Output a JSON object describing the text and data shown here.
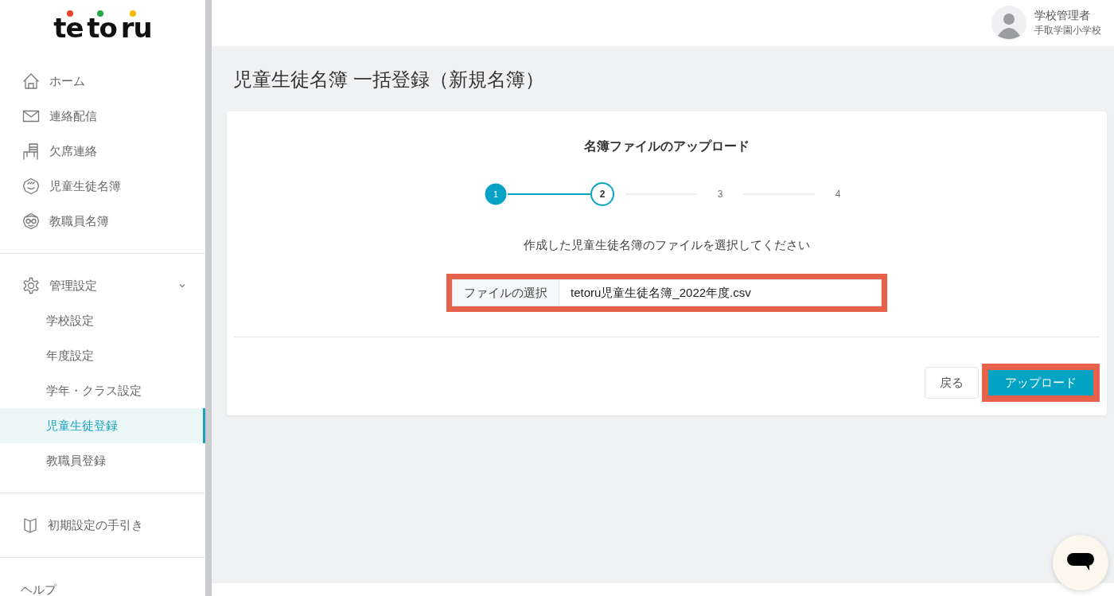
{
  "logo": "te to ru",
  "sidebar": {
    "main_items": [
      {
        "label": "ホーム",
        "selected": false
      },
      {
        "label": "連絡配信",
        "selected": false
      },
      {
        "label": "欠席連絡",
        "selected": false
      },
      {
        "label": "児童生徒名簿",
        "selected": false
      },
      {
        "label": "教職員名簿",
        "selected": false
      }
    ],
    "settings": {
      "label": "管理設定",
      "expanded": true,
      "children": [
        {
          "label": "学校設定",
          "selected": false
        },
        {
          "label": "年度設定",
          "selected": false
        },
        {
          "label": "学年・クラス設定",
          "selected": false
        },
        {
          "label": "児童生徒登録",
          "selected": true
        },
        {
          "label": "教職員登録",
          "selected": false
        }
      ]
    },
    "guide": {
      "label": "初期設定の手引き"
    },
    "help": {
      "label": "ヘルプ"
    }
  },
  "header": {
    "user": {
      "name": "学校管理者",
      "school": "手取学園小学校"
    }
  },
  "page_title": "児童生徒名簿 一括登録（新規名簿）",
  "card": {
    "title": "名簿ファイルのアップロード",
    "steps": [
      {
        "label": "1",
        "completed": true,
        "active": false
      },
      {
        "label": "2",
        "completed": false,
        "active": true
      },
      {
        "label": "3",
        "completed": false,
        "active": false
      },
      {
        "label": "4",
        "completed": false,
        "active": false
      }
    ],
    "instruction": "作成した児童生徒名簿のファイルを選択してください",
    "file_field": {
      "button": "ファイルの選択",
      "value": "tetoru児童生徒名簿_2022年度.csv",
      "highlighted": true
    },
    "buttons": [
      {
        "label": "戻る",
        "kind": "secondary",
        "highlighted": false
      },
      {
        "label": "アップロード",
        "kind": "primary",
        "highlighted": true
      }
    ]
  }
}
